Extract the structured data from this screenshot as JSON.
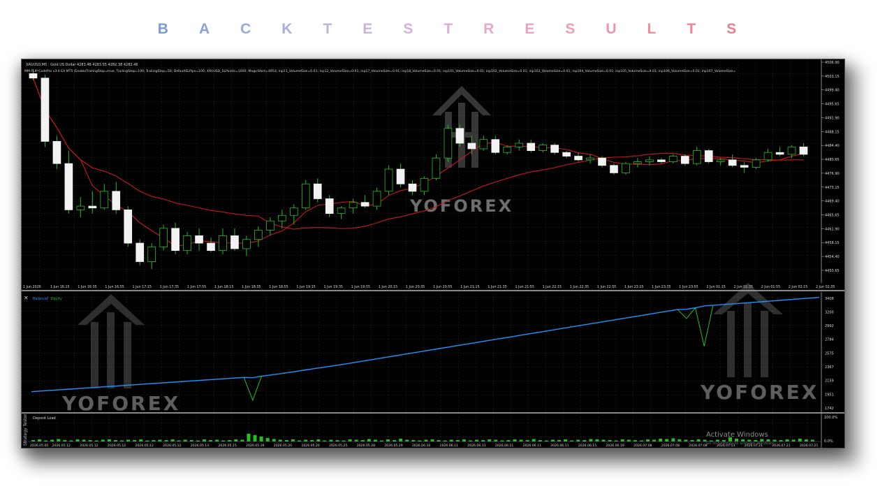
{
  "page_title_letters": [
    "B",
    "A",
    "C",
    "K",
    "T",
    "E",
    "S",
    "T",
    "R",
    "E",
    "S",
    "U",
    "L",
    "T",
    "S"
  ],
  "title_colors": [
    "#7b9ad6",
    "#8aa2da",
    "#9aa8dc",
    "#aaafdf",
    "#bcb3e0",
    "#c9b4df",
    "#d3b1dc",
    "#dcaed7",
    "#e4a9cf",
    "#eba3c5",
    "#ee9cba",
    "#ef94ae",
    "#ee8ca2",
    "#ec8496",
    "#ea7c8b"
  ],
  "price_chart": {
    "header_line1": "XAUUSD,M5 : Gold US Dollar  4283.48 4283.55 4282.38 4282.46",
    "header_line2": "MM FLIP CodePro v3.0 EA MT5 [EnableTrailingStop=true; TrailingStep=100; TrailingStop=50; DefaultSLPips=100; XAUUSD_SLPoints=1000; MagicStart=4953; inp11_VolumeSize=0.01; inp12_VolumeSize=0.01; inp17_VolumeSize=0.01; inp18_VolumeSize=0.01; inp101_VolumeSize=0.01; inp102_VolumeSize=0.01; inp103_VolumeSize=0.01; inp104_VolumeSize=0.01; inp105_VolumeSize=0.01; inp106_VolumeSize=0.01; inp107_VolumeSize=",
    "price_axis": [
      "4506.90",
      "4503.15",
      "4499.40",
      "4495.65",
      "4491.90",
      "4488.15",
      "4484.40",
      "4480.65",
      "4476.90",
      "4473.15",
      "4469.40",
      "4465.65",
      "4461.90",
      "4458.15",
      "4454.40",
      "4450.65"
    ],
    "time_axis": [
      "1 Jun 2026",
      "1 Jun 16:15",
      "1 Jun 16:35",
      "1 Jun 16:55",
      "1 Jun 17:15",
      "1 Jun 17:35",
      "1 Jun 17:55",
      "1 Jun 18:15",
      "1 Jun 18:35",
      "1 Jun 18:55",
      "1 Jun 19:15",
      "1 Jun 19:35",
      "1 Jun 19:55",
      "1 Jun 20:15",
      "1 Jun 20:35",
      "1 Jun 20:55",
      "1 Jun 21:15",
      "1 Jun 21:35",
      "1 Jun 21:55",
      "1 Jun 22:15",
      "1 Jun 22:35",
      "1 Jun 22:55",
      "1 Jun 23:15",
      "1 Jun 23:35",
      "1 Jun 23:55",
      "2 Jun 01:15",
      "2 Jun 01:35",
      "2 Jun 01:55",
      "2 Jun 02:15",
      "2 Jun 02:35"
    ],
    "candles": [
      [
        4503.8,
        4505.0,
        4502.0,
        4502.6
      ],
      [
        4502.6,
        4503.5,
        4484.0,
        4485.5
      ],
      [
        4485.5,
        4487.0,
        4478.0,
        4479.5
      ],
      [
        4479.5,
        4483.0,
        4466.0,
        4467.0
      ],
      [
        4467.0,
        4470.5,
        4465.0,
        4468.0
      ],
      [
        4468.0,
        4472.0,
        4466.0,
        4467.5
      ],
      [
        4467.5,
        4474.0,
        4467.0,
        4472.0
      ],
      [
        4472.0,
        4474.5,
        4466.0,
        4467.0
      ],
      [
        4467.0,
        4468.0,
        4457.0,
        4458.0
      ],
      [
        4458.0,
        4459.0,
        4452.0,
        4453.0
      ],
      [
        4453.0,
        4458.0,
        4451.0,
        4457.0
      ],
      [
        4457.0,
        4463.0,
        4456.0,
        4462.0
      ],
      [
        4462.0,
        4463.5,
        4455.0,
        4456.0
      ],
      [
        4456.0,
        4461.0,
        4455.0,
        4460.0
      ],
      [
        4460.0,
        4462.0,
        4456.0,
        4458.0
      ],
      [
        4458.0,
        4459.5,
        4455.5,
        4456.0
      ],
      [
        4456.0,
        4462.0,
        4455.0,
        4460.0
      ],
      [
        4460.0,
        4462.0,
        4456.0,
        4456.5
      ],
      [
        4456.5,
        4460.0,
        4454.5,
        4459.0
      ],
      [
        4459.0,
        4462.5,
        4457.0,
        4461.5
      ],
      [
        4461.5,
        4465.0,
        4460.0,
        4464.0
      ],
      [
        4464.0,
        4467.0,
        4462.0,
        4465.5
      ],
      [
        4465.5,
        4468.5,
        4463.0,
        4467.5
      ],
      [
        4467.5,
        4475.0,
        4467.0,
        4474.0
      ],
      [
        4474.0,
        4475.5,
        4469.0,
        4470.0
      ],
      [
        4470.0,
        4471.0,
        4465.0,
        4466.0
      ],
      [
        4466.0,
        4468.0,
        4464.5,
        4467.5
      ],
      [
        4467.5,
        4470.0,
        4466.0,
        4469.0
      ],
      [
        4469.0,
        4471.0,
        4467.5,
        4468.0
      ],
      [
        4468.0,
        4473.0,
        4467.0,
        4472.0
      ],
      [
        4472.0,
        4479.0,
        4471.0,
        4478.0
      ],
      [
        4478.0,
        4479.5,
        4473.0,
        4474.0
      ],
      [
        4474.0,
        4475.0,
        4471.0,
        4472.0
      ],
      [
        4472.0,
        4476.0,
        4471.0,
        4475.5
      ],
      [
        4475.5,
        4482.0,
        4475.0,
        4481.0
      ],
      [
        4481.0,
        4490.0,
        4480.0,
        4489.0
      ],
      [
        4489.0,
        4490.0,
        4484.0,
        4485.0
      ],
      [
        4485.0,
        4487.0,
        4482.0,
        4483.5
      ],
      [
        4483.5,
        4487.0,
        4483.0,
        4486.0
      ],
      [
        4486.0,
        4487.0,
        4482.0,
        4482.5
      ],
      [
        4482.5,
        4484.5,
        4482.0,
        4484.0
      ],
      [
        4484.0,
        4486.0,
        4483.0,
        4485.0
      ],
      [
        4485.0,
        4486.0,
        4482.5,
        4483.0
      ],
      [
        4483.0,
        4485.0,
        4482.5,
        4484.5
      ],
      [
        4484.5,
        4485.0,
        4482.0,
        4482.5
      ],
      [
        4482.5,
        4483.0,
        4481.0,
        4481.5
      ],
      [
        4481.5,
        4482.5,
        4480.0,
        4480.5
      ],
      [
        4480.5,
        4482.0,
        4479.5,
        4481.0
      ],
      [
        4481.0,
        4481.5,
        4478.5,
        4479.0
      ],
      [
        4479.0,
        4479.5,
        4476.5,
        4477.0
      ],
      [
        4477.0,
        4480.0,
        4476.5,
        4479.5
      ],
      [
        4479.5,
        4481.0,
        4478.5,
        4480.0
      ],
      [
        4480.0,
        4481.5,
        4479.0,
        4480.5
      ],
      [
        4480.5,
        4481.0,
        4479.5,
        4480.0
      ],
      [
        4480.0,
        4482.0,
        4479.5,
        4481.5
      ],
      [
        4481.5,
        4482.0,
        4479.0,
        4479.5
      ],
      [
        4479.5,
        4484.0,
        4479.0,
        4483.0
      ],
      [
        4483.0,
        4483.5,
        4479.5,
        4480.0
      ],
      [
        4480.0,
        4481.0,
        4479.0,
        4480.5
      ],
      [
        4480.5,
        4482.0,
        4478.5,
        4479.0
      ],
      [
        4479.0,
        4480.0,
        4477.0,
        4478.5
      ],
      [
        4478.5,
        4481.0,
        4478.0,
        4480.5
      ],
      [
        4480.5,
        4483.5,
        4480.0,
        4482.5
      ],
      [
        4482.5,
        4484.0,
        4481.5,
        4482.0
      ],
      [
        4482.0,
        4484.5,
        4481.0,
        4484.0
      ],
      [
        4484.0,
        4485.0,
        4481.5,
        4482.0
      ]
    ]
  },
  "equity_chart": {
    "legend_balance": "Balance",
    "legend_separator": " / ",
    "legend_equity": "Equity",
    "legend_balance_color": "#1e90ff",
    "legend_equity_color": "#22c022",
    "axis_labels": [
      "3408",
      "3200",
      "2992",
      "2784",
      "2575",
      "2367",
      "2159",
      "1951",
      "1742"
    ],
    "balance": [
      1990,
      1999,
      2008,
      2017,
      2026,
      2035,
      2044,
      2053,
      2062,
      2071,
      2080,
      2089,
      2098,
      2107,
      2116,
      2125,
      2134,
      2143,
      2152,
      2161,
      2170,
      2179,
      2188,
      2197,
      2206,
      2202,
      2225,
      2242,
      2260,
      2280,
      2300,
      2320,
      2340,
      2360,
      2380,
      2400,
      2422,
      2444,
      2466,
      2488,
      2510,
      2532,
      2554,
      2576,
      2598,
      2620,
      2642,
      2664,
      2686,
      2708,
      2730,
      2752,
      2774,
      2796,
      2818,
      2840,
      2862,
      2884,
      2906,
      2928,
      2950,
      2972,
      2994,
      3016,
      3038,
      3060,
      3082,
      3104,
      3126,
      3148,
      3170,
      3192,
      3214,
      3236,
      3240,
      3262,
      3290,
      3300,
      3310,
      3320,
      3330,
      3340,
      3350,
      3360,
      3370,
      3380,
      3390,
      3400,
      3410,
      3420
    ],
    "equity": [
      1990,
      1999,
      2008,
      2017,
      2026,
      2035,
      2044,
      2053,
      2062,
      2071,
      2080,
      2089,
      2098,
      2107,
      2116,
      2125,
      2134,
      2143,
      2152,
      2161,
      2170,
      2179,
      2188,
      2197,
      2206,
      1860,
      2225,
      2242,
      2260,
      2280,
      2300,
      2320,
      2340,
      2360,
      2380,
      2400,
      2422,
      2444,
      2466,
      2488,
      2510,
      2532,
      2554,
      2576,
      2598,
      2620,
      2642,
      2664,
      2686,
      2708,
      2730,
      2752,
      2774,
      2796,
      2818,
      2840,
      2862,
      2884,
      2906,
      2928,
      2950,
      2972,
      2994,
      3016,
      3038,
      3060,
      3082,
      3104,
      3126,
      3148,
      3170,
      3192,
      3214,
      3236,
      3100,
      3262,
      2680,
      3300,
      3310,
      3320,
      3330,
      3340,
      3350,
      3360,
      3370,
      3380,
      3390,
      3400,
      3410,
      3420
    ]
  },
  "deposit_load": {
    "label": "Deposit Load",
    "axis_top": "100.0%",
    "axis_bottom": "0.0%",
    "vertical_tab": "Strategy Tester",
    "date_axis": [
      "2026.05.05",
      "2026.05.12",
      "2026.05.12",
      "2026.05.12",
      "2026.05.12",
      "2026.05.12",
      "2026.05.13",
      "2026.05.15",
      "2026.05.19",
      "2026.05.20",
      "2026.05.20",
      "2026.05.25",
      "2026.05.28",
      "2026.05.29",
      "2026.06.10",
      "2026.06.11",
      "2026.06.11",
      "2026.06.11",
      "2026.06.11",
      "2026.06.11",
      "2026.06.15",
      "2026.06.19",
      "2026.07.08",
      "2026.07.08",
      "2026.07.08",
      "2026.07.13",
      "2026.07.21",
      "2026.07.21",
      "2026.07.21"
    ],
    "bars": [
      4,
      6,
      3,
      5,
      7,
      4,
      3,
      6,
      5,
      4,
      3,
      5,
      6,
      4,
      3,
      5,
      4,
      6,
      3,
      4,
      5,
      4,
      6,
      3,
      5,
      4,
      3,
      6,
      4,
      5,
      3,
      4,
      6,
      5,
      22,
      18,
      14,
      10,
      7,
      5,
      4,
      6,
      3,
      5,
      4,
      6,
      3,
      5,
      4,
      3,
      6,
      5,
      4,
      7,
      5,
      3,
      6,
      4,
      8,
      5,
      4,
      3,
      5,
      6,
      4,
      3,
      5,
      4,
      6,
      3,
      5,
      4,
      6,
      5,
      3,
      4,
      6,
      5,
      4,
      7,
      4,
      3,
      5,
      4,
      6,
      3,
      5,
      4,
      7,
      6,
      5,
      4,
      3,
      6,
      5,
      4,
      3,
      6,
      5,
      8,
      7,
      9,
      6,
      5,
      4,
      6,
      5,
      3,
      5,
      4,
      12,
      8,
      6,
      5,
      4,
      7,
      6,
      5,
      4,
      6,
      5,
      8,
      6,
      5
    ]
  },
  "watermark_text": "YOFOREX",
  "os_watermark": {
    "line1": "Activate Windows",
    "line2": "Go to Settings to activate Windows."
  }
}
